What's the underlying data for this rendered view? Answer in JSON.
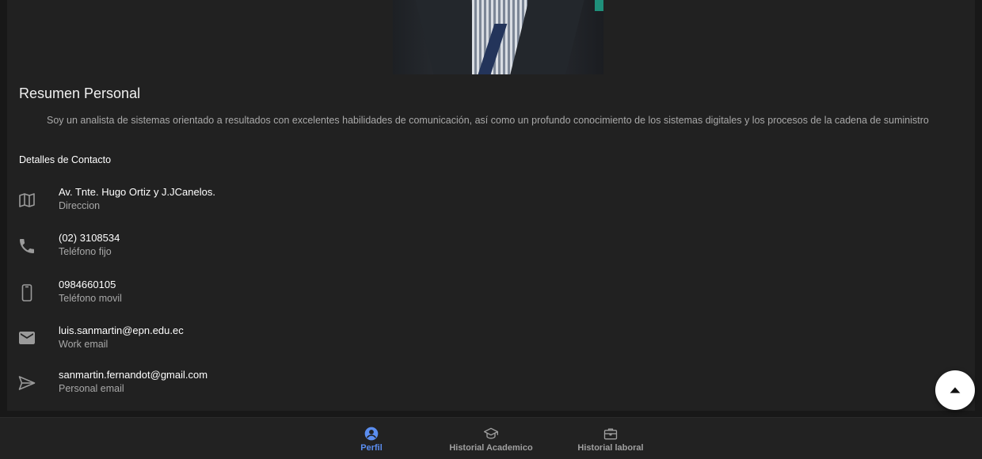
{
  "profile": {
    "summary_title": "Resumen Personal",
    "summary_text": "Soy un analista de sistemas orientado a resultados con excelentes habilidades de comunicación, así como un profundo conocimiento de los sistemas digitales y los procesos de la cadena de suministro"
  },
  "contact": {
    "title": "Detalles de Contacto",
    "items": [
      {
        "icon": "map-icon",
        "primary": "Av. Tnte. Hugo Ortiz y J.JCanelos.",
        "secondary": "Direccion"
      },
      {
        "icon": "phone-icon",
        "primary": "(02) 3108534",
        "secondary": "Teléfono fijo"
      },
      {
        "icon": "smartphone-icon",
        "primary": "0984660105",
        "secondary": "Teléfono movil"
      },
      {
        "icon": "mail-icon",
        "primary": "luis.sanmartin@epn.edu.ec",
        "secondary": "Work email"
      },
      {
        "icon": "send-icon",
        "primary": "sanmartin.fernandot@gmail.com",
        "secondary": "Personal email"
      }
    ]
  },
  "scroll_top": {
    "icon": "arrow-up-icon"
  },
  "bottom_nav": {
    "active_color": "#5b8ef0",
    "items": [
      {
        "label": "Perfil",
        "icon": "account-circle-icon",
        "active": true
      },
      {
        "label": "Historial Academico",
        "icon": "school-icon",
        "active": false
      },
      {
        "label": "Historial laboral",
        "icon": "briefcase-icon",
        "active": false
      }
    ]
  }
}
